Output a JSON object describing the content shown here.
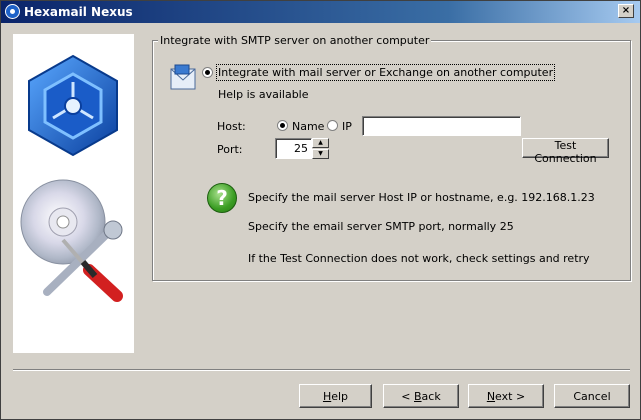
{
  "window": {
    "title": "Hexamail Nexus",
    "close_glyph": "×"
  },
  "group": {
    "legend": "Integrate with SMTP server on another computer",
    "option_label": "Integrate with mail server or Exchange on another computer",
    "help_text": "Help is available"
  },
  "host": {
    "label": "Host:",
    "name_option": "Name",
    "ip_option": "IP",
    "value": "",
    "selected": "Name"
  },
  "port": {
    "label": "Port:",
    "value": "25"
  },
  "test_button": "Test Connection",
  "hints": [
    "Specify the mail server Host IP or hostname, e.g. 192.168.1.23",
    "Specify the email server SMTP port, normally 25",
    "If the Test Connection does not work, check settings and retry"
  ],
  "help_icon_glyph": "?",
  "buttons": {
    "help": {
      "hotkey": "H",
      "rest": "elp"
    },
    "back": {
      "prefix": "< ",
      "hotkey": "B",
      "rest": "ack"
    },
    "next": {
      "hotkey": "N",
      "rest": "ext >"
    },
    "cancel": "Cancel"
  },
  "icons": [
    "hexagon-logo-icon",
    "cd-tools-icon",
    "mail-icon",
    "help-icon",
    "close-icon"
  ]
}
